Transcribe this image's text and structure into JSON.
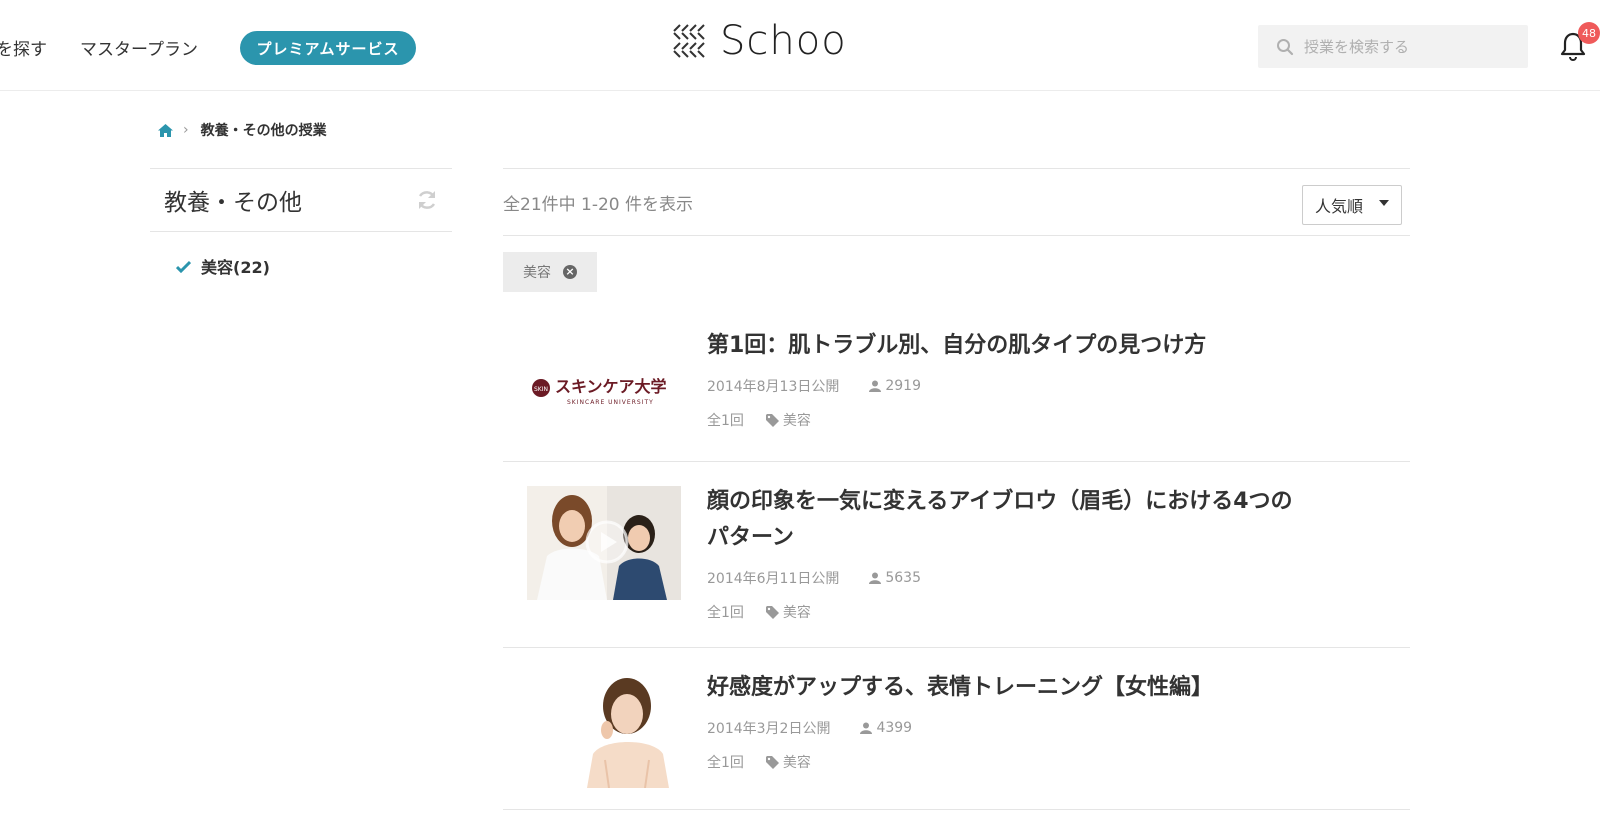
{
  "header": {
    "nav_find": "を探す",
    "nav_master": "マスタープラン",
    "premium_label": "プレミアムサービス",
    "logo_text": "Schoo",
    "search_placeholder": "授業を検索する",
    "notification_count": "48",
    "accent_color": "#2b95ad"
  },
  "breadcrumb": {
    "current": "教養・その他の授業"
  },
  "sidebar": {
    "title": "教養・その他",
    "filters": [
      {
        "label": "美容(22)",
        "checked": true
      }
    ]
  },
  "main": {
    "result_count": "全21件中 1-20 件を表示",
    "sort_label": "人気順",
    "active_tag": "美容",
    "courses": [
      {
        "title": "第1回：肌トラブル別、自分の肌タイプの見つけ方",
        "date": "2014年8月13日公開",
        "views": "2919",
        "episodes": "全1回",
        "tag": "美容",
        "thumb_text": "スキンケア大学",
        "thumb_subtext": "SKINCARE UNIVERSITY"
      },
      {
        "title_line1": "顔の印象を一気に変えるアイブロウ（眉毛）における4つの",
        "title_line2": "パターン",
        "date": "2014年6月11日公開",
        "views": "5635",
        "episodes": "全1回",
        "tag": "美容"
      },
      {
        "title": "好感度がアップする、表情トレーニング【女性編】",
        "date": "2014年3月2日公開",
        "views": "4399",
        "episodes": "全1回",
        "tag": "美容"
      }
    ]
  }
}
